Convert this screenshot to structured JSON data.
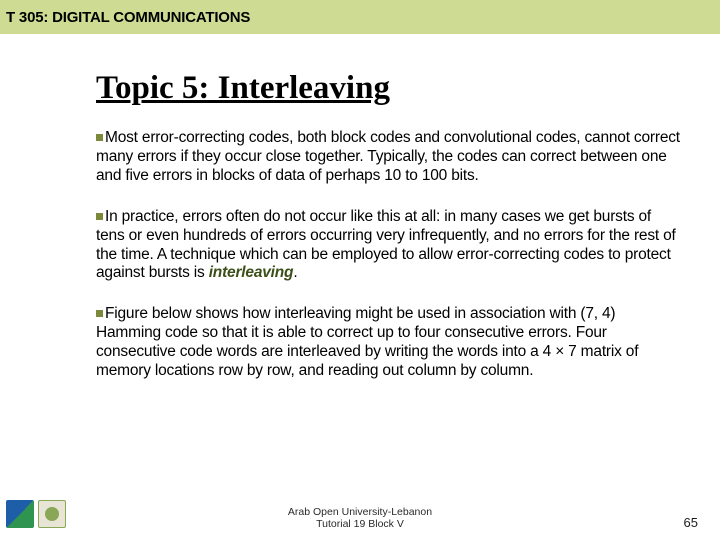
{
  "header": {
    "title": "T 305: DIGITAL COMMUNICATIONS"
  },
  "topic": {
    "title": "Topic 5: Interleaving"
  },
  "paragraphs": {
    "p1": "Most error-correcting codes, both block codes and convolutional codes, cannot correct many errors if they occur close together. Typically, the codes can correct between one and five errors in blocks of data of perhaps 10 to 100 bits.",
    "p2a": "In practice, errors often do not occur like this at all: in many cases we get bursts of tens or even hundreds of errors occurring very infrequently, and no errors for the rest of the time. A technique which can be employed to allow error-correcting codes to protect against bursts is ",
    "p2_emph": "interleaving",
    "p2b": ".",
    "p3": "Figure below shows how interleaving might be used in association with (7, 4) Hamming code so that it is able to correct up to four consecutive errors. Four consecutive code words are interleaved by writing the words into a 4 × 7 matrix of memory locations row by row, and reading out column by column."
  },
  "footer": {
    "line1": "Arab Open University-Lebanon",
    "line2": "Tutorial 19 Block V"
  },
  "pagenum": "65"
}
